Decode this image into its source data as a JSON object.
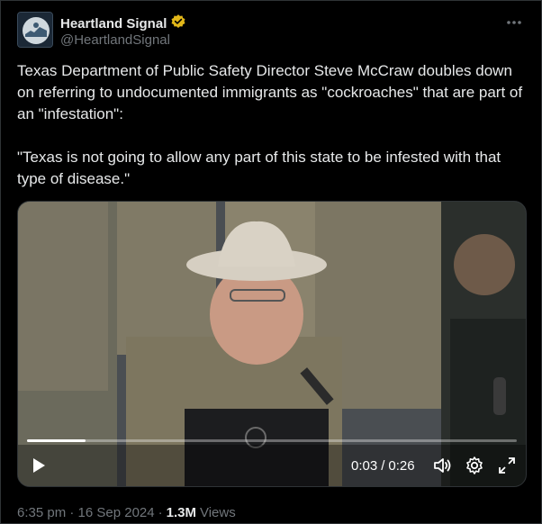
{
  "post": {
    "author": {
      "display_name": "Heartland Signal",
      "handle": "@HeartlandSignal",
      "verified_badge_color": "#e2b719",
      "avatar_icon": "heartland-signal-logo"
    },
    "more_icon": "more-horizontal-icon",
    "text": "Texas Department of Public Safety Director Steve McCraw doubles down on referring to undocumented immigrants as \"cockroaches\" that are part of an \"infestation\":\n\n\"Texas is not going to allow any part of this state to be infested with that type of disease.\"",
    "video": {
      "current_time": "0:03",
      "separator": "/",
      "duration": "0:26",
      "progress": 0.12,
      "controls": [
        "play-icon",
        "volume-icon",
        "settings-icon",
        "fullscreen-icon"
      ]
    },
    "timestamp": "6:35 pm · 16 Sep 2024",
    "dot": "·",
    "views_count": "1.3M",
    "views_label": "Views"
  },
  "colors": {
    "background": "#000000",
    "text_primary": "#e7e9ea",
    "text_secondary": "#71767b",
    "border": "#2f3336"
  }
}
